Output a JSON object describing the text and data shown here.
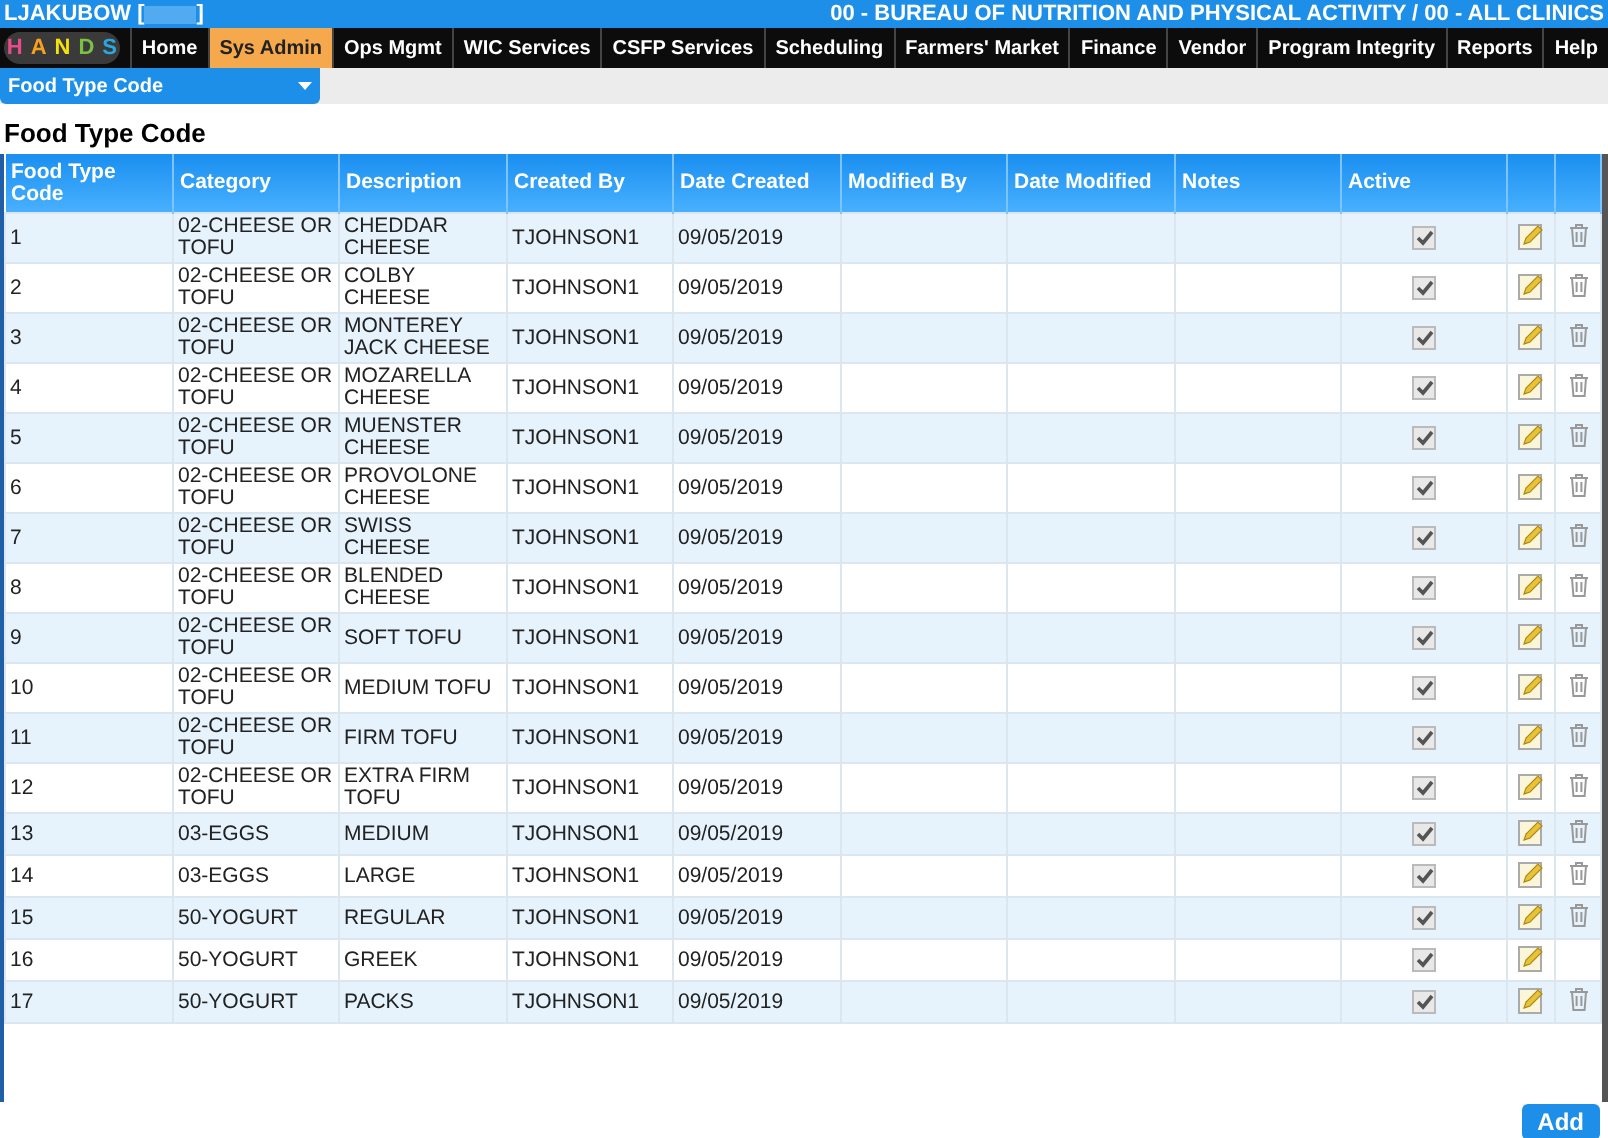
{
  "header": {
    "user": "LJAKUBOW [",
    "user_close": "]",
    "agency": "00 - BUREAU OF NUTRITION AND PHYSICAL ACTIVITY / 00 - ALL CLINICS"
  },
  "logo_letters": [
    "H",
    "A",
    "N",
    "D",
    "S"
  ],
  "nav": [
    {
      "label": "Home",
      "selected": false
    },
    {
      "label": "Sys Admin",
      "selected": true
    },
    {
      "label": "Ops Mgmt",
      "selected": false
    },
    {
      "label": "WIC Services",
      "selected": false
    },
    {
      "label": "CSFP Services",
      "selected": false
    },
    {
      "label": "Scheduling",
      "selected": false
    },
    {
      "label": "Farmers' Market",
      "selected": false
    },
    {
      "label": "Finance",
      "selected": false
    },
    {
      "label": "Vendor",
      "selected": false
    },
    {
      "label": "Program Integrity",
      "selected": false
    },
    {
      "label": "Reports",
      "selected": false
    },
    {
      "label": "Help",
      "selected": false
    }
  ],
  "page_select": {
    "value": "Food Type Code"
  },
  "title": "Food Type Code",
  "table": {
    "columns": [
      "Food Type Code",
      "Category",
      "Description",
      "Created By",
      "Date Created",
      "Modified By",
      "Date Modified",
      "Notes",
      "Active"
    ],
    "rows": [
      {
        "code": "1",
        "category": "02-CHEESE OR TOFU",
        "description": "CHEDDAR CHEESE",
        "created_by": "TJOHNSON1",
        "date_created": "09/05/2019",
        "active": true,
        "deletable": true
      },
      {
        "code": "2",
        "category": "02-CHEESE OR TOFU",
        "description": "COLBY CHEESE",
        "created_by": "TJOHNSON1",
        "date_created": "09/05/2019",
        "active": true,
        "deletable": true
      },
      {
        "code": "3",
        "category": "02-CHEESE OR TOFU",
        "description": "MONTEREY JACK CHEESE",
        "created_by": "TJOHNSON1",
        "date_created": "09/05/2019",
        "active": true,
        "deletable": true
      },
      {
        "code": "4",
        "category": "02-CHEESE OR TOFU",
        "description": "MOZARELLA CHEESE",
        "created_by": "TJOHNSON1",
        "date_created": "09/05/2019",
        "active": true,
        "deletable": true
      },
      {
        "code": "5",
        "category": "02-CHEESE OR TOFU",
        "description": "MUENSTER CHEESE",
        "created_by": "TJOHNSON1",
        "date_created": "09/05/2019",
        "active": true,
        "deletable": true
      },
      {
        "code": "6",
        "category": "02-CHEESE OR TOFU",
        "description": "PROVOLONE CHEESE",
        "created_by": "TJOHNSON1",
        "date_created": "09/05/2019",
        "active": true,
        "deletable": true
      },
      {
        "code": "7",
        "category": "02-CHEESE OR TOFU",
        "description": "SWISS CHEESE",
        "created_by": "TJOHNSON1",
        "date_created": "09/05/2019",
        "active": true,
        "deletable": true
      },
      {
        "code": "8",
        "category": "02-CHEESE OR TOFU",
        "description": "BLENDED CHEESE",
        "created_by": "TJOHNSON1",
        "date_created": "09/05/2019",
        "active": true,
        "deletable": true
      },
      {
        "code": "9",
        "category": "02-CHEESE OR TOFU",
        "description": "SOFT TOFU",
        "created_by": "TJOHNSON1",
        "date_created": "09/05/2019",
        "active": true,
        "deletable": true
      },
      {
        "code": "10",
        "category": "02-CHEESE OR TOFU",
        "description": "MEDIUM TOFU",
        "created_by": "TJOHNSON1",
        "date_created": "09/05/2019",
        "active": true,
        "deletable": true
      },
      {
        "code": "11",
        "category": "02-CHEESE OR TOFU",
        "description": "FIRM TOFU",
        "created_by": "TJOHNSON1",
        "date_created": "09/05/2019",
        "active": true,
        "deletable": true
      },
      {
        "code": "12",
        "category": "02-CHEESE OR TOFU",
        "description": "EXTRA FIRM TOFU",
        "created_by": "TJOHNSON1",
        "date_created": "09/05/2019",
        "active": true,
        "deletable": true
      },
      {
        "code": "13",
        "category": "03-EGGS",
        "description": "MEDIUM",
        "created_by": "TJOHNSON1",
        "date_created": "09/05/2019",
        "active": true,
        "deletable": true
      },
      {
        "code": "14",
        "category": "03-EGGS",
        "description": "LARGE",
        "created_by": "TJOHNSON1",
        "date_created": "09/05/2019",
        "active": true,
        "deletable": true
      },
      {
        "code": "15",
        "category": "50-YOGURT",
        "description": "REGULAR",
        "created_by": "TJOHNSON1",
        "date_created": "09/05/2019",
        "active": true,
        "deletable": true
      },
      {
        "code": "16",
        "category": "50-YOGURT",
        "description": "GREEK",
        "created_by": "TJOHNSON1",
        "date_created": "09/05/2019",
        "active": true,
        "deletable": false
      },
      {
        "code": "17",
        "category": "50-YOGURT",
        "description": "PACKS",
        "created_by": "TJOHNSON1",
        "date_created": "09/05/2019",
        "active": true,
        "deletable": true
      }
    ]
  },
  "add_button": "Add"
}
